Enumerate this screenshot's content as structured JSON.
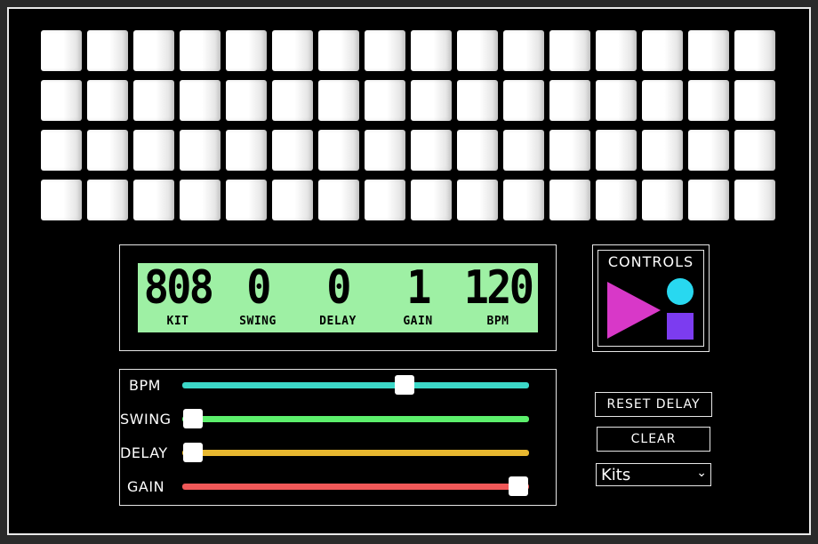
{
  "display": {
    "kit": {
      "value": "808",
      "label": "KIT"
    },
    "swing": {
      "value": "0",
      "label": "SWING"
    },
    "delay": {
      "value": "0",
      "label": "DELAY"
    },
    "gain": {
      "value": "1",
      "label": "GAIN"
    },
    "bpm": {
      "value": "120",
      "label": "BPM"
    }
  },
  "controls": {
    "title": "CONTROLS",
    "play_icon": "play-triangle",
    "record_icon": "circle",
    "stop_icon": "square",
    "colors": {
      "play": "#d838c8",
      "circle": "#28d8f0",
      "square": "#7c3cf0"
    }
  },
  "sliders": [
    {
      "name": "bpm",
      "label": "BPM",
      "color": "#3cd8c8",
      "level": 0.65
    },
    {
      "name": "swing",
      "label": "SWING",
      "color": "#5cf06c",
      "level": 0.0
    },
    {
      "name": "delay",
      "label": "DELAY",
      "color": "#e8b830",
      "level": 0.0
    },
    {
      "name": "gain",
      "label": "GAIN",
      "color": "#f05858",
      "level": 1.0
    }
  ],
  "buttons": {
    "reset_delay": "RESET DELAY",
    "clear": "CLEAR"
  },
  "kits_select": {
    "selected": "Kits",
    "chevron_icon": "chevron-down-icon"
  }
}
